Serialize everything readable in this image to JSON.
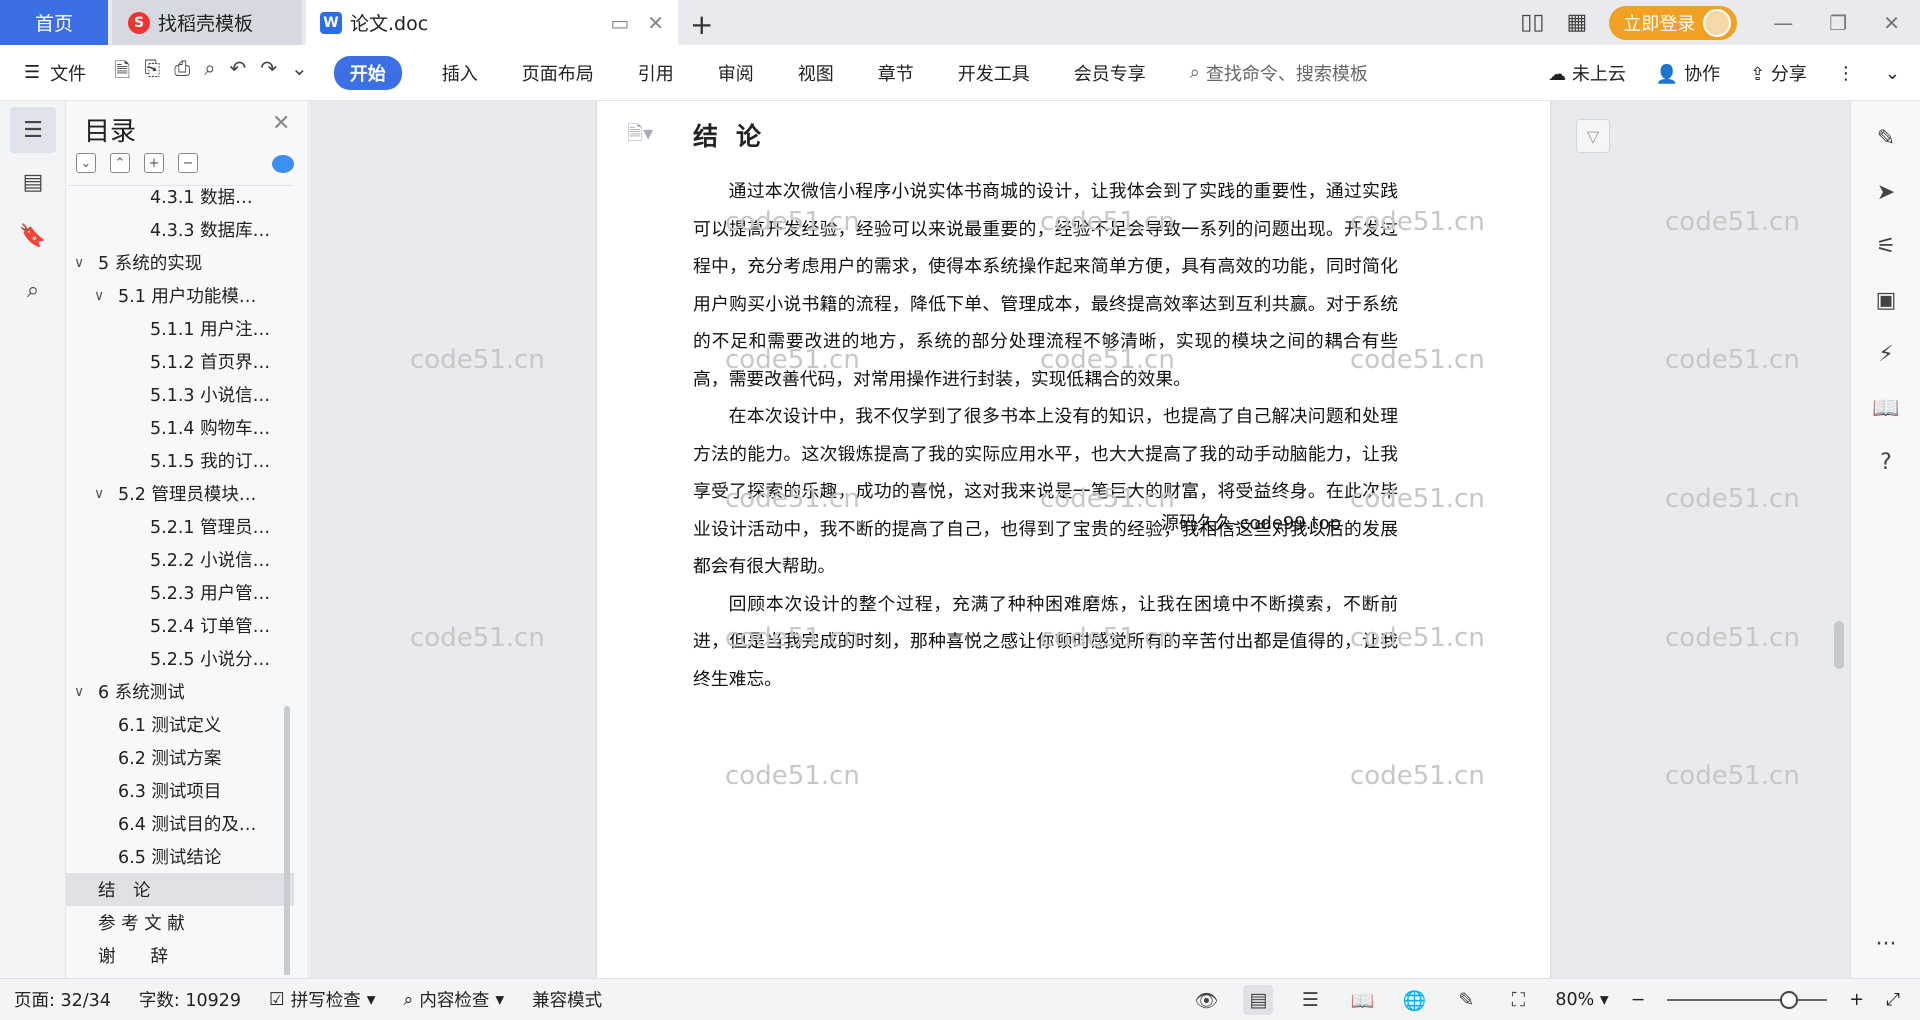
{
  "tabs": {
    "home": "首页",
    "template": "找稻壳模板",
    "doc": "论文.doc"
  },
  "titlebar": {
    "login": "立即登录"
  },
  "ribbon": {
    "file": "文件",
    "items": [
      "开始",
      "插入",
      "页面布局",
      "引用",
      "审阅",
      "视图",
      "章节",
      "开发工具",
      "会员专享"
    ],
    "search_placeholder": "查找命令、搜索模板",
    "cloud": "未上云",
    "collab": "协作",
    "share": "分享"
  },
  "toc": {
    "title": "目录",
    "items": [
      {
        "label": "4.3.1 数据…",
        "level": 3,
        "caret": ""
      },
      {
        "label": "4.3.3 数据库…",
        "level": 3,
        "caret": ""
      },
      {
        "label": "5  系统的实现",
        "level": 1,
        "caret": "∨"
      },
      {
        "label": "5.1 用户功能模…",
        "level": 2,
        "caret": "∨"
      },
      {
        "label": "5.1.1 用户注…",
        "level": 3,
        "caret": ""
      },
      {
        "label": "5.1.2 首页界…",
        "level": 3,
        "caret": ""
      },
      {
        "label": "5.1.3 小说信…",
        "level": 3,
        "caret": ""
      },
      {
        "label": "5.1.4 购物车…",
        "level": 3,
        "caret": ""
      },
      {
        "label": "5.1.5 我的订…",
        "level": 3,
        "caret": ""
      },
      {
        "label": "5.2 管理员模块…",
        "level": 2,
        "caret": "∨"
      },
      {
        "label": "5.2.1 管理员…",
        "level": 3,
        "caret": ""
      },
      {
        "label": "5.2.2 小说信…",
        "level": 3,
        "caret": ""
      },
      {
        "label": "5.2.3 用户管…",
        "level": 3,
        "caret": ""
      },
      {
        "label": "5.2.4 订单管…",
        "level": 3,
        "caret": ""
      },
      {
        "label": "5.2.5 小说分…",
        "level": 3,
        "caret": ""
      },
      {
        "label": "6 系统测试",
        "level": 1,
        "caret": "∨"
      },
      {
        "label": "6.1 测试定义",
        "level": 2,
        "caret": ""
      },
      {
        "label": "6.2 测试方案",
        "level": 2,
        "caret": ""
      },
      {
        "label": "6.3 测试项目",
        "level": 2,
        "caret": ""
      },
      {
        "label": "6.4 测试目的及…",
        "level": 2,
        "caret": ""
      },
      {
        "label": "6.5 测试结论",
        "level": 2,
        "caret": ""
      },
      {
        "label": "结　论",
        "level": 1,
        "caret": "",
        "active": true
      },
      {
        "label": "参 考 文 献",
        "level": 1,
        "caret": ""
      },
      {
        "label": "谢　　辞",
        "level": 1,
        "caret": ""
      }
    ]
  },
  "document": {
    "heading": "结论",
    "paragraphs": [
      "通过本次微信小程序小说实体书商城的设计，让我体会到了实践的重要性，通过实践可以提高开发经验，经验可以来说最重要的，经验不足会导致一系列的问题出现。开发过程中，充分考虑用户的需求，使得本系统操作起来简单方便，具有高效的功能，同时简化用户购买小说书籍的流程，降低下单、管理成本，最终提高效率达到互利共赢。对于系统的不足和需要改进的地方，系统的部分处理流程不够清晰，实现的模块之间的耦合有些高，需要改善代码，对常用操作进行封装，实现低耦合的效果。",
      "在本次设计中，我不仅学到了很多书本上没有的知识，也提高了自己解决问题和处理方法的能力。这次锻炼提高了我的实际应用水平，也大大提高了我的动手动脑能力，让我享受了探索的乐趣，成功的喜悦，这对我来说是一笔巨大的财富，将受益终身。在此次毕业设计活动中，我不断的提高了自己，也得到了宝贵的经验，我相信这些对我以后的发展都会有很大帮助。",
      "回顾本次设计的整个过程，充满了种种困难磨炼，让我在困境中不断摸索，不断前进，但是当我完成的时刻，那种喜悦之感让你顿时感觉所有的辛苦付出都是值得的，让我终生难忘。"
    ],
    "watermark": "code51.cn",
    "center_watermark": "源码久久-code99.top"
  },
  "status": {
    "page": "页面: 32/34",
    "words": "字数: 10929",
    "spell": "拼写检查",
    "content": "内容检查",
    "compat": "兼容模式",
    "zoom": "80%",
    "zoom_level": 0.8
  }
}
